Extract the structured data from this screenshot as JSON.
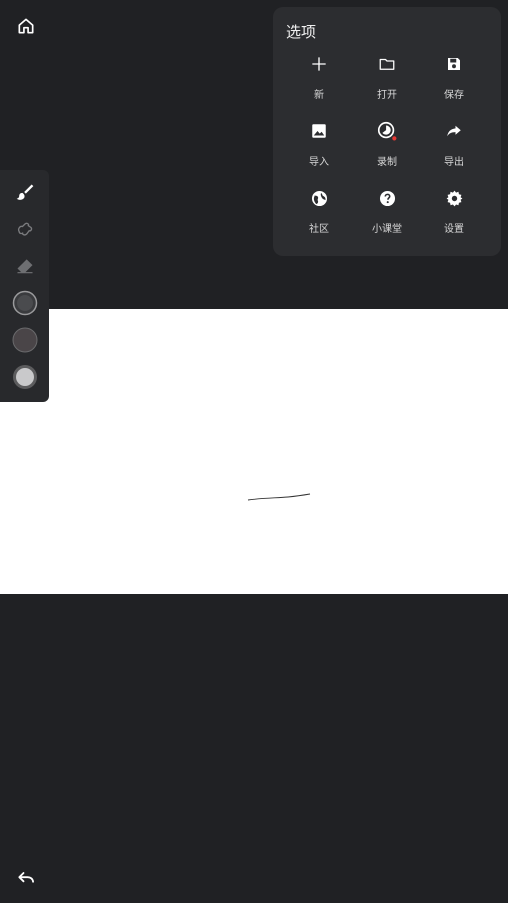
{
  "top": {
    "home_icon": "home-icon"
  },
  "options": {
    "title": "选项",
    "items": [
      {
        "label": "新",
        "icon": "plus-icon"
      },
      {
        "label": "打开",
        "icon": "folder-icon"
      },
      {
        "label": "保存",
        "icon": "save-icon"
      },
      {
        "label": "导入",
        "icon": "image-icon"
      },
      {
        "label": "录制",
        "icon": "record-icon"
      },
      {
        "label": "导出",
        "icon": "share-icon"
      },
      {
        "label": "社区",
        "icon": "globe-icon"
      },
      {
        "label": "小课堂",
        "icon": "help-icon"
      },
      {
        "label": "设置",
        "icon": "gear-icon"
      }
    ]
  },
  "toolbar": {
    "tools": [
      "brush-icon",
      "smudge-icon",
      "eraser-icon",
      "brush-size-icon",
      "color-icon",
      "opacity-icon"
    ],
    "active_color": "#4a4548"
  },
  "bottom": {
    "undo_icon": "undo-icon"
  },
  "colors": {
    "background": "#202124",
    "panel": "#2c2d30",
    "canvas": "#ffffff",
    "record_dot": "#e53935"
  }
}
